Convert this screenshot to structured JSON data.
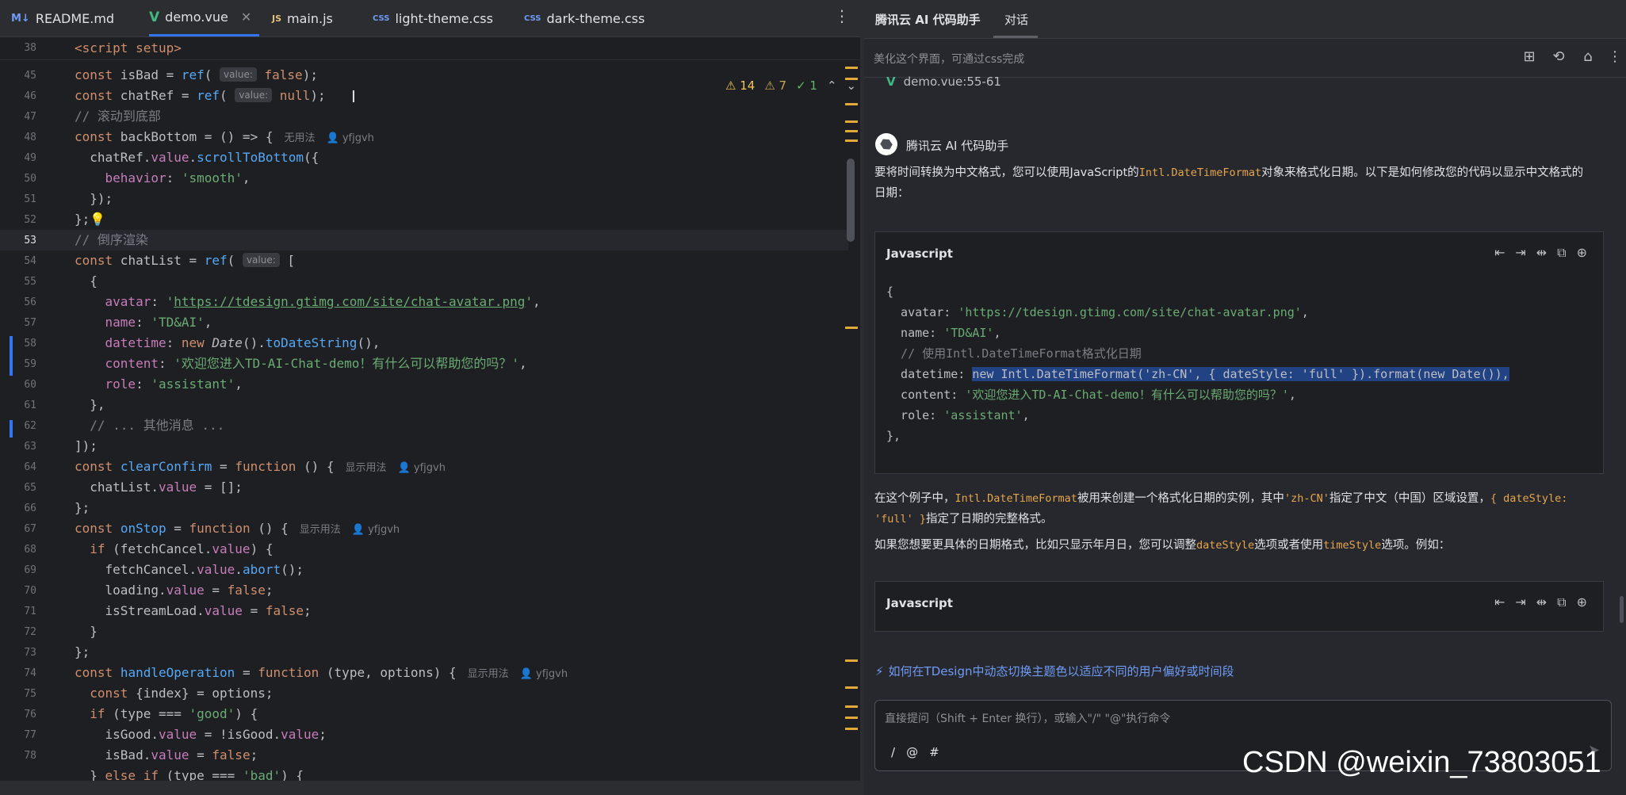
{
  "editor": {
    "tabs": [
      {
        "name": "README.md",
        "icon": "M↓"
      },
      {
        "name": "demo.vue",
        "icon": "V",
        "active": true
      },
      {
        "name": "main.js",
        "icon": "JS"
      },
      {
        "name": "light-theme.css",
        "icon": "CSS"
      },
      {
        "name": "dark-theme.css",
        "icon": "CSS"
      }
    ],
    "more_icon": "⋮",
    "sticky_line_number": "38",
    "sticky_code": "<script setup>",
    "inspections": {
      "warnings": "14",
      "weak_warnings": "7",
      "ok": "1"
    },
    "line_numbers": [
      "45",
      "46",
      "47",
      "48",
      "49",
      "50",
      "51",
      "52",
      "53",
      "54",
      "55",
      "56",
      "57",
      "58",
      "59",
      "60",
      "61",
      "62",
      "63",
      "64",
      "65",
      "66",
      "67",
      "68",
      "69",
      "70",
      "71",
      "72",
      "73",
      "74",
      "75",
      "76",
      "77",
      "78"
    ],
    "current_line": "53",
    "hints": {
      "value": "value:",
      "no_usage": "无用法",
      "show_usage": "显示用法",
      "author": "yfjgvh"
    },
    "comments": {
      "scroll_bottom": "// 滚动到底部",
      "reverse_render": "// 倒序渲染",
      "other_msgs": "// ... 其他消息 ..."
    },
    "strings": {
      "smooth": "'smooth'",
      "avatar_url": "https://tdesign.gtimg.com/site/chat-avatar.png",
      "name": "'TD&AI'",
      "content": "'欢迎您进入TD-AI-Chat-demo！有什么可以帮助您的吗？'",
      "role": "'assistant'",
      "good": "'good'",
      "bad": "'bad'"
    }
  },
  "assistant": {
    "title": "腾讯云 AI 代码助手",
    "tab_chat": "对话",
    "context_placeholder": "美化这个界面，可通过css完成",
    "ref_file": "demo.vue:55-61",
    "ai_name": "腾讯云 AI 代码助手",
    "intro_pre": "要将时间转换为中文格式，您可以使用JavaScript的",
    "intro_code": "Intl.DateTimeFormat",
    "intro_post": "对象来格式化日期。以下是如何修改您的代码以显示中文格式的",
    "intro_line2": "日期：",
    "code_title": "Javascript",
    "code1": {
      "open": "{",
      "avatar_key": "  avatar: ",
      "avatar_val": "'https://tdesign.gtimg.com/site/chat-avatar.png'",
      "name_key": "  name: ",
      "name_val": "'TD&AI'",
      "comment": "  // 使用Intl.DateTimeFormat格式化日期",
      "datetime_key": "  datetime: ",
      "datetime_val": "new Intl.DateTimeFormat('zh-CN', { dateStyle: 'full' }).format(new Date()),",
      "content_key": "  content: ",
      "content_val": "'欢迎您进入TD-AI-Chat-demo！有什么可以帮助您的吗？'",
      "role_key": "  role: ",
      "role_val": "'assistant'",
      "close": "},"
    },
    "explain": {
      "p1": "在这个例子中，",
      "c1": "Intl.DateTimeFormat",
      "p2": "被用来创建一个格式化日期的实例，其中",
      "c2": "'zh-CN'",
      "p3": "指定了中文（中国）区域设置，",
      "c3a": "{ dateStyle:",
      "c3b": "'full' }",
      "p4": "指定了日期的完整格式。"
    },
    "more": {
      "p1": "如果您想要更具体的日期格式，比如只显示年月日，您可以调整",
      "c1": "dateStyle",
      "p2": "选项或者使用",
      "c2": "timeStyle",
      "p3": "选项。例如："
    },
    "code2_title": "Javascript",
    "suggestion": "如何在TDesign中动态切换主题色以适应不同的用户偏好或时间段",
    "input_placeholder": "直接提问（Shift + Enter 换行），或输入\"/\" \"@\"执行命令",
    "input_tools": [
      "/",
      "@",
      "#"
    ]
  },
  "watermark": "CSDN @weixin_73803051",
  "colors": {
    "accent": "#3574f0",
    "vue": "#42b883",
    "warning": "#f2c55c"
  }
}
